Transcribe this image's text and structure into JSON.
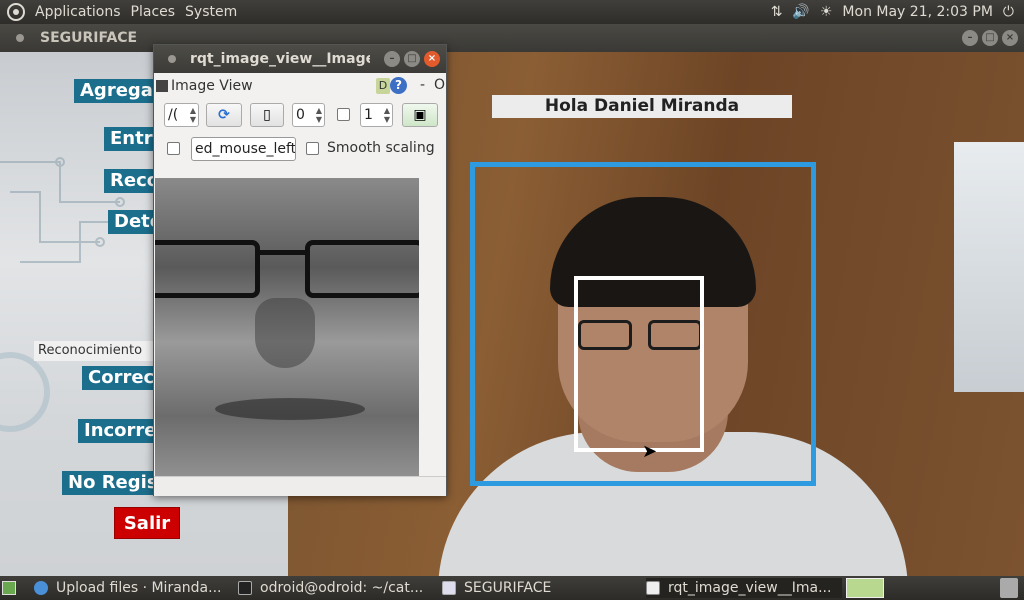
{
  "top_panel": {
    "menus": [
      "Applications",
      "Places",
      "System"
    ],
    "tray": {
      "network_icon": "network-updown-icon",
      "volume_icon": "volume-icon",
      "weather_icon": "weather-sun-icon",
      "datetime": "Mon May 21,  2:03 PM",
      "power_icon": "power-icon"
    }
  },
  "seguriface_window": {
    "title": "SEGURIFACE",
    "buttons": {
      "agregar": "Agregar U",
      "entrenar": "Entre",
      "reconocer": "Recon",
      "detectar": "Dete",
      "correcto": "Correct",
      "incorrecto": "Incorrec",
      "no_registrado": "No Regist",
      "salir": "Salir"
    },
    "reconocimiento_label": "Reconocimiento",
    "greeting": "Hola Daniel Miranda",
    "colors": {
      "button_bg": "#1b6e8c",
      "salir_bg": "#cc0000",
      "face_box_outer": "#2e9be0",
      "face_box_inner": "#ffffff"
    }
  },
  "rqt_window": {
    "title": "rqt_image_view__ImageV",
    "header_title": "Image View",
    "header_d": "D",
    "header_help": "?",
    "header_dash": "-",
    "header_o": "O",
    "topic_combo": "/(",
    "spin_a": "0",
    "spin_b": "1",
    "mouse_topic": "ed_mouse_left",
    "smooth_scaling_label": "Smooth scaling"
  },
  "taskbar": {
    "tasks": [
      {
        "label": "Upload files · Miranda...",
        "icon": "chrome-icon"
      },
      {
        "label": "odroid@odroid: ~/cat...",
        "icon": "terminal-icon"
      },
      {
        "label": "SEGURIFACE",
        "icon": "window-icon"
      },
      {
        "label": "rqt_image_view__Ima...",
        "icon": "window-icon"
      }
    ]
  }
}
